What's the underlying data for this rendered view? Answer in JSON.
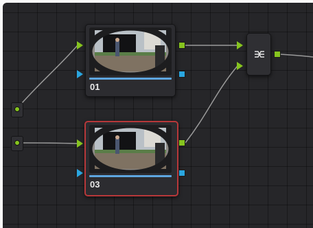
{
  "nodes": [
    {
      "id": "01",
      "label": "01",
      "selected": false
    },
    {
      "id": "03",
      "label": "03",
      "selected": true
    }
  ],
  "colors": {
    "background": "#262629",
    "node_fill": "#2c2c30",
    "selected_border": "#b7383a",
    "rgb_port": "#86c41f",
    "alpha_port": "#2aa6e0",
    "wire": "#9a9a9a",
    "node_progress_bar": "#5ea6e0"
  },
  "icons": {
    "mixer": "layer-mixer-icon",
    "source": "source-input-icon",
    "thumbnail": "video-thumbnail-icon"
  }
}
